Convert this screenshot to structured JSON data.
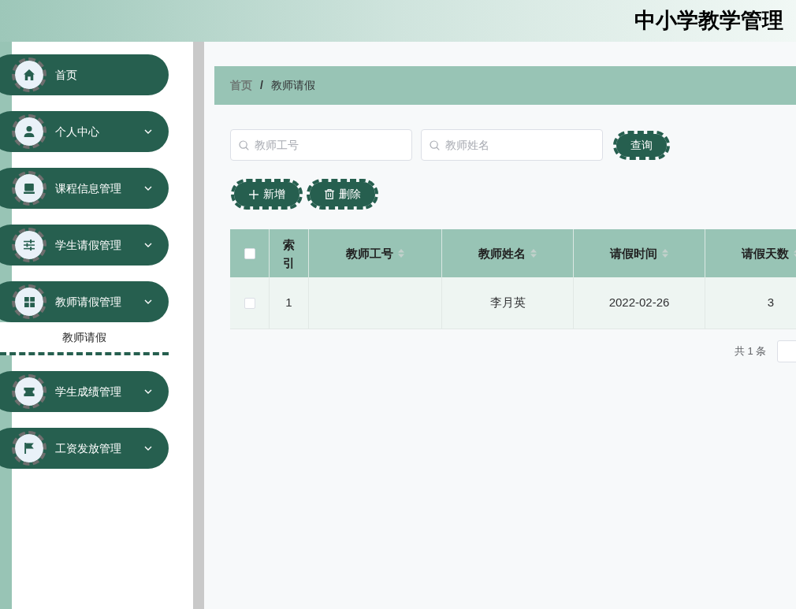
{
  "header": {
    "title": "中小学教学管理"
  },
  "sidebar": {
    "items": [
      {
        "label": "首页",
        "kind": "link"
      },
      {
        "label": "个人中心",
        "kind": "submenu",
        "expanded": false
      },
      {
        "label": "课程信息管理",
        "kind": "submenu",
        "expanded": false
      },
      {
        "label": "学生请假管理",
        "kind": "submenu",
        "expanded": false
      },
      {
        "label": "教师请假管理",
        "kind": "submenu",
        "expanded": true,
        "children": [
          {
            "label": "教师请假",
            "selected": true
          }
        ]
      },
      {
        "label": "学生成绩管理",
        "kind": "submenu",
        "expanded": false
      },
      {
        "label": "工资发放管理",
        "kind": "submenu",
        "expanded": false
      }
    ]
  },
  "breadcrumb": {
    "separator": "/",
    "items": [
      {
        "label": "首页",
        "current": false
      },
      {
        "label": "教师请假",
        "current": true
      }
    ]
  },
  "search": {
    "fields": [
      {
        "placeholder": "教师工号"
      },
      {
        "placeholder": "教师姓名"
      }
    ],
    "button": {
      "label": "查询"
    }
  },
  "actions": [
    {
      "label": "新增",
      "kind": "add"
    },
    {
      "label": "删除",
      "kind": "delete"
    }
  ],
  "table": {
    "select_all": {
      "checked": false
    },
    "columns": [
      {
        "label": "索引",
        "sortable": false
      },
      {
        "label": "教师工号",
        "sortable": true
      },
      {
        "label": "教师姓名",
        "sortable": true
      },
      {
        "label": "请假时间",
        "sortable": true
      },
      {
        "label": "请假天数",
        "sortable": true
      }
    ],
    "rows": [
      {
        "checked": false,
        "cells": [
          "1",
          null,
          "李月英",
          "2022-02-26",
          "3"
        ]
      }
    ]
  },
  "pagination": {
    "total": "共 1 条"
  }
}
